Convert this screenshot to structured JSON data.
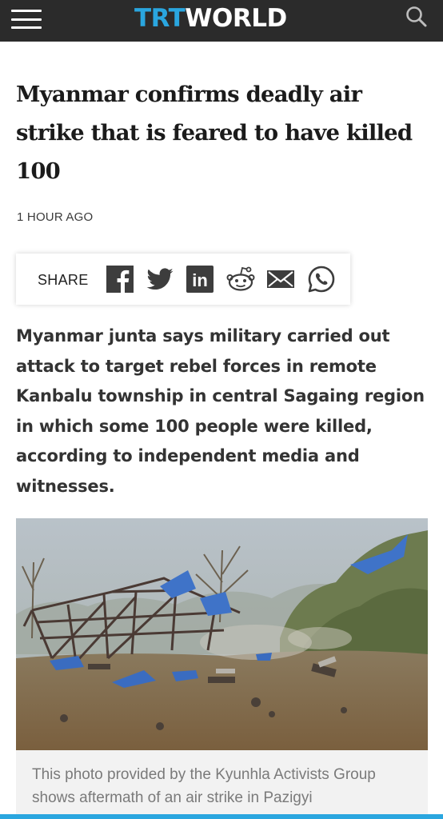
{
  "header": {
    "logo_trt": "TRT",
    "logo_world": "WORLD",
    "menu_icon": "hamburger-menu-icon",
    "search_icon": "search-icon",
    "brand_color": "#2aa6df",
    "bar_color": "#2b2b2b"
  },
  "article": {
    "headline": "Myanmar confirms deadly air strike that is feared to have killed 100",
    "timestamp": "1 HOUR AGO",
    "summary": "Myanmar junta says military carried out attack to target rebel forces in remote Kanbalu township in central Sagaing region in which some 100 people were killed, according to independent media and witnesses.",
    "photo_caption": "This photo provided by the Kyunhla Activists Group shows aftermath of an air strike in Pazigyi"
  },
  "share": {
    "label": "SHARE",
    "icons": [
      "facebook-icon",
      "twitter-icon",
      "linkedin-icon",
      "reddit-icon",
      "email-icon",
      "whatsapp-icon"
    ],
    "linkedin_text": "in"
  }
}
